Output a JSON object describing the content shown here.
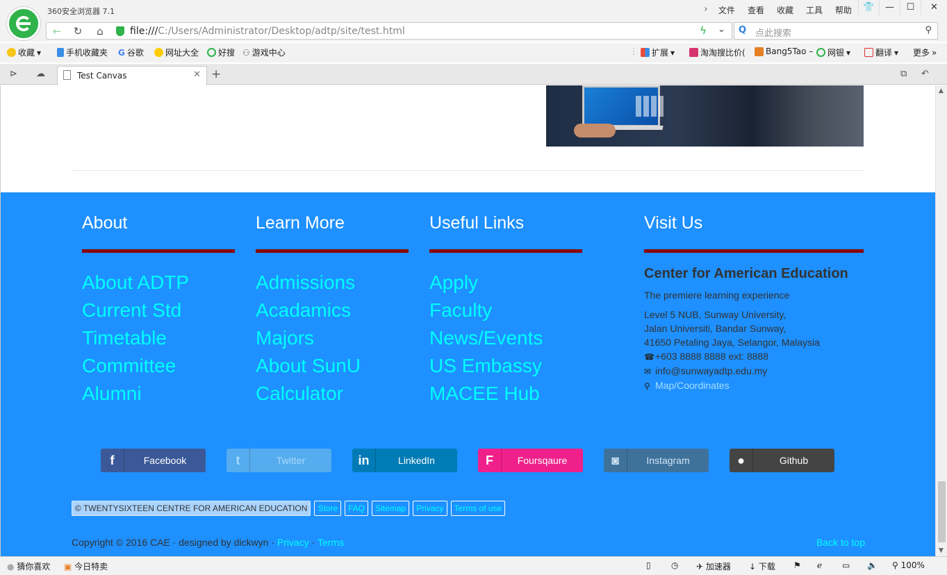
{
  "browser": {
    "app_title": "360安全浏览器 7.1",
    "menu": [
      "文件",
      "查看",
      "收藏",
      "工具",
      "帮助"
    ],
    "url_prefix": "file:///",
    "url_path": "C:/Users/Administrator/Desktop/adtp/site/test.html",
    "search_placeholder": "点此搜索",
    "bookmarks": {
      "favorites": "收藏",
      "mobile": "手机收藏夹",
      "google": "谷歌",
      "sites": "网址大全",
      "haosou": "好搜",
      "games": "游戏中心",
      "extensions": "扩展",
      "taotao": "淘淘搜比价(",
      "bang5tao": "Bang5Tao –",
      "bank": "网银",
      "translate": "翻译",
      "more": "更多"
    },
    "tab_title": "Test Canvas",
    "status": {
      "guess": "猜你喜欢",
      "deals": "今日特卖",
      "accelerator": "加速器",
      "download": "下载",
      "zoom": "100%"
    }
  },
  "footer": {
    "columns": [
      {
        "heading": "About",
        "links": [
          "About ADTP",
          "Current Std",
          "Timetable",
          "Committee",
          "Alumni"
        ]
      },
      {
        "heading": "Learn More",
        "links": [
          "Admissions",
          "Acadamics",
          "Majors",
          "About SunU",
          "Calculator"
        ]
      },
      {
        "heading": "Useful Links",
        "links": [
          "Apply",
          "Faculty",
          "News/Events",
          "US Embassy",
          "MACEE Hub"
        ]
      }
    ],
    "visit": {
      "heading": "Visit Us",
      "org": "Center for American Education",
      "tagline": "The premiere learning experience",
      "address": [
        "Level 5 NUB, Sunway University,",
        "Jalan Universiti, Bandar Sunway,",
        "41650 Petaling Jaya, Selangor, Malaysia"
      ],
      "phone": "+603 8888 8888 ext: 8888",
      "email": "info@sunwayadtp.edu.my",
      "map": "Map/Coordinates"
    },
    "socials": [
      {
        "label": "Facebook",
        "icon": "f",
        "color": "#3b5998"
      },
      {
        "label": "Twitter",
        "icon": "t",
        "color": "#55acee"
      },
      {
        "label": "LinkedIn",
        "icon": "in",
        "color": "#007bb6"
      },
      {
        "label": "Foursqaure",
        "icon": "F",
        "color": "#f94877"
      },
      {
        "label": "Instagram",
        "icon": "◙",
        "color": "#3f729b"
      },
      {
        "label": "Github",
        "icon": "●",
        "color": "#444444"
      }
    ],
    "legal": {
      "copyright_pill": "TWENTYSIXTEEN CENTRE FOR AMERICAN EDUCATION",
      "links": [
        "Store",
        "FAQ",
        "Sitemap",
        "Privacy",
        "Terms of use"
      ]
    },
    "bottom": {
      "copyright": "Copyright © 2016 CAE · designed by dickwyn ·",
      "privacy": "Privacy",
      "sep": "·",
      "terms": "Terms",
      "back_to_top": "Back to top"
    }
  }
}
